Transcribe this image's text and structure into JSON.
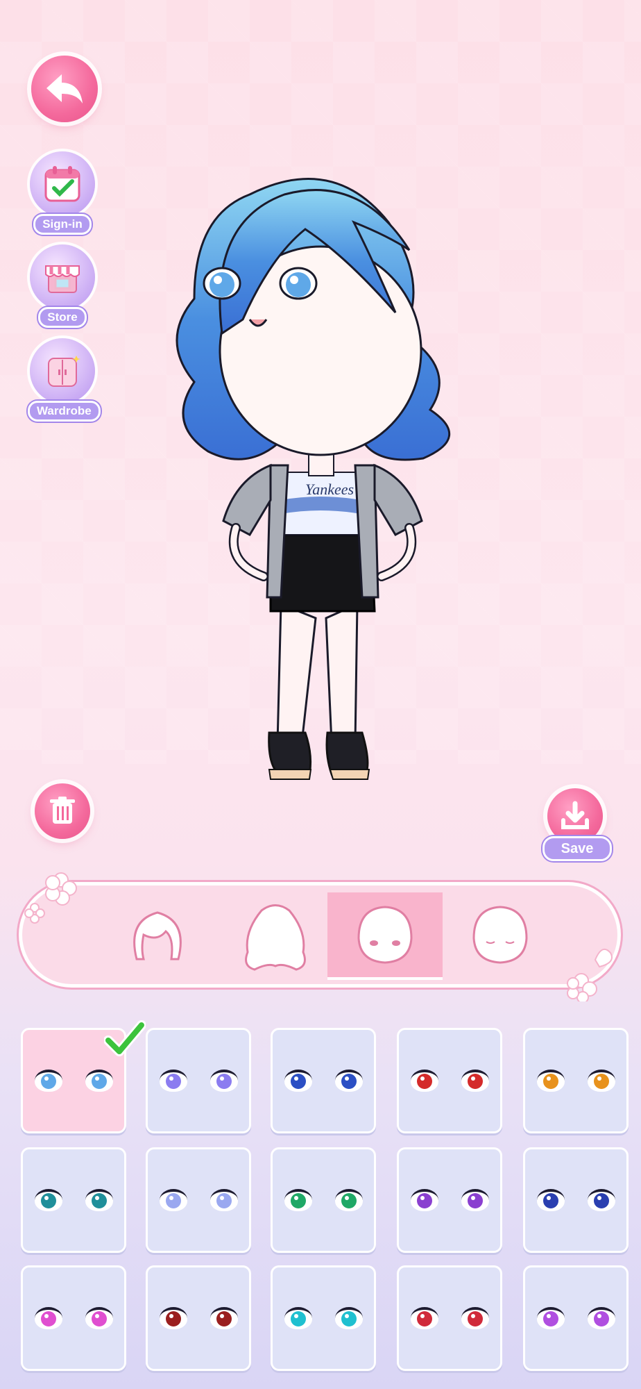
{
  "sidebar": {
    "items": [
      {
        "label": "Sign-in",
        "icon": "calendar-check-icon"
      },
      {
        "label": "Store",
        "icon": "shop-icon"
      },
      {
        "label": "Wardrobe",
        "icon": "wardrobe-icon"
      }
    ]
  },
  "actions": {
    "back_icon": "back-arrow-icon",
    "delete_icon": "trash-icon",
    "save_icon": "download-icon",
    "save_label": "Save"
  },
  "character": {
    "shirt_text": "Yankees"
  },
  "category_tabs": [
    {
      "name": "hair-front",
      "active": false
    },
    {
      "name": "hair-back",
      "active": false
    },
    {
      "name": "eyes",
      "active": true
    },
    {
      "name": "face",
      "active": false
    }
  ],
  "eye_options": [
    {
      "iris": "#5fa8e8",
      "selected": true
    },
    {
      "iris": "#8b7cf0",
      "selected": false
    },
    {
      "iris": "#2b4fc4",
      "selected": false
    },
    {
      "iris": "#d42a2a",
      "selected": false
    },
    {
      "iris": "#e8921c",
      "selected": false
    },
    {
      "iris": "#1f8f9a",
      "selected": false
    },
    {
      "iris": "#9aa8f0",
      "selected": false
    },
    {
      "iris": "#1fa866",
      "selected": false
    },
    {
      "iris": "#8a3fd0",
      "selected": false
    },
    {
      "iris": "#2a3fb0",
      "selected": false
    },
    {
      "iris": "#e04fd0",
      "selected": false
    },
    {
      "iris": "#9a1f1f",
      "selected": false
    },
    {
      "iris": "#1fc0d0",
      "selected": false
    },
    {
      "iris": "#d02a3a",
      "selected": false
    },
    {
      "iris": "#b04fe0",
      "selected": false
    }
  ],
  "colors": {
    "accent_pink": "#f4699c",
    "label_purple": "#b29bf0",
    "check_green": "#3cc33c"
  }
}
